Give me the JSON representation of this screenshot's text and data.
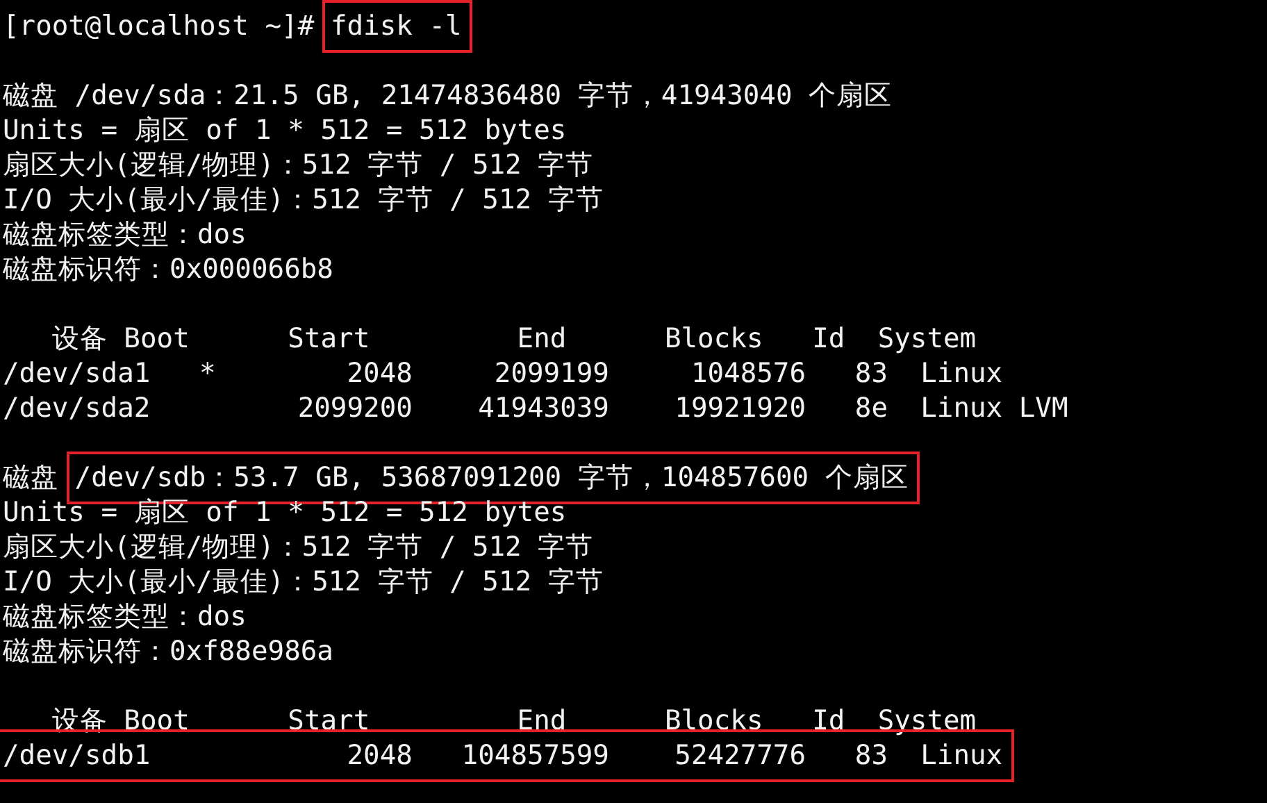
{
  "terminal": {
    "lines": [
      {
        "kind": "text",
        "segments": [
          {
            "text": "[root@localhost ~]# ",
            "boxed": false
          },
          {
            "text": "fdisk -l",
            "boxed": true
          }
        ]
      },
      {
        "kind": "blank"
      },
      {
        "kind": "text",
        "segments": [
          {
            "text": "磁盘 /dev/sda：21.5 GB, 21474836480 字节，41943040 个扇区",
            "boxed": false
          }
        ]
      },
      {
        "kind": "text",
        "segments": [
          {
            "text": "Units = 扇区 of 1 * 512 = 512 bytes",
            "boxed": false
          }
        ]
      },
      {
        "kind": "text",
        "segments": [
          {
            "text": "扇区大小(逻辑/物理)：512 字节 / 512 字节",
            "boxed": false
          }
        ]
      },
      {
        "kind": "text",
        "segments": [
          {
            "text": "I/O 大小(最小/最佳)：512 字节 / 512 字节",
            "boxed": false
          }
        ]
      },
      {
        "kind": "text",
        "segments": [
          {
            "text": "磁盘标签类型：dos",
            "boxed": false
          }
        ]
      },
      {
        "kind": "text",
        "segments": [
          {
            "text": "磁盘标识符：0x000066b8",
            "boxed": false
          }
        ]
      },
      {
        "kind": "blank"
      },
      {
        "kind": "text",
        "segments": [
          {
            "text": "   设备 Boot      Start         End      Blocks   Id  System",
            "boxed": false
          }
        ]
      },
      {
        "kind": "text",
        "segments": [
          {
            "text": "/dev/sda1   *        2048     2099199     1048576   83  Linux",
            "boxed": false
          }
        ]
      },
      {
        "kind": "text",
        "segments": [
          {
            "text": "/dev/sda2         2099200    41943039    19921920   8e  Linux LVM",
            "boxed": false
          }
        ]
      },
      {
        "kind": "blank"
      },
      {
        "kind": "text",
        "segments": [
          {
            "text": "磁盘 ",
            "boxed": false
          },
          {
            "text": "/dev/sdb：53.7 GB, 53687091200 字节，104857600 个扇区",
            "boxed": true
          }
        ]
      },
      {
        "kind": "text",
        "segments": [
          {
            "text": "Units = 扇区 of 1 * 512 = 512 bytes",
            "boxed": false
          }
        ]
      },
      {
        "kind": "text",
        "segments": [
          {
            "text": "扇区大小(逻辑/物理)：512 字节 / 512 字节",
            "boxed": false
          }
        ]
      },
      {
        "kind": "text",
        "segments": [
          {
            "text": "I/O 大小(最小/最佳)：512 字节 / 512 字节",
            "boxed": false
          }
        ]
      },
      {
        "kind": "text",
        "segments": [
          {
            "text": "磁盘标签类型：dos",
            "boxed": false
          }
        ]
      },
      {
        "kind": "text",
        "segments": [
          {
            "text": "磁盘标识符：0xf88e986a",
            "boxed": false
          }
        ]
      },
      {
        "kind": "blank"
      },
      {
        "kind": "text",
        "segments": [
          {
            "text": "   设备 Boot      Start         End      Blocks   Id  System",
            "boxed": false
          }
        ]
      },
      {
        "kind": "text",
        "segments": [
          {
            "text": "/dev/sdb1            2048   104857599    52427776   83  Linux",
            "boxed": true
          }
        ]
      }
    ]
  }
}
